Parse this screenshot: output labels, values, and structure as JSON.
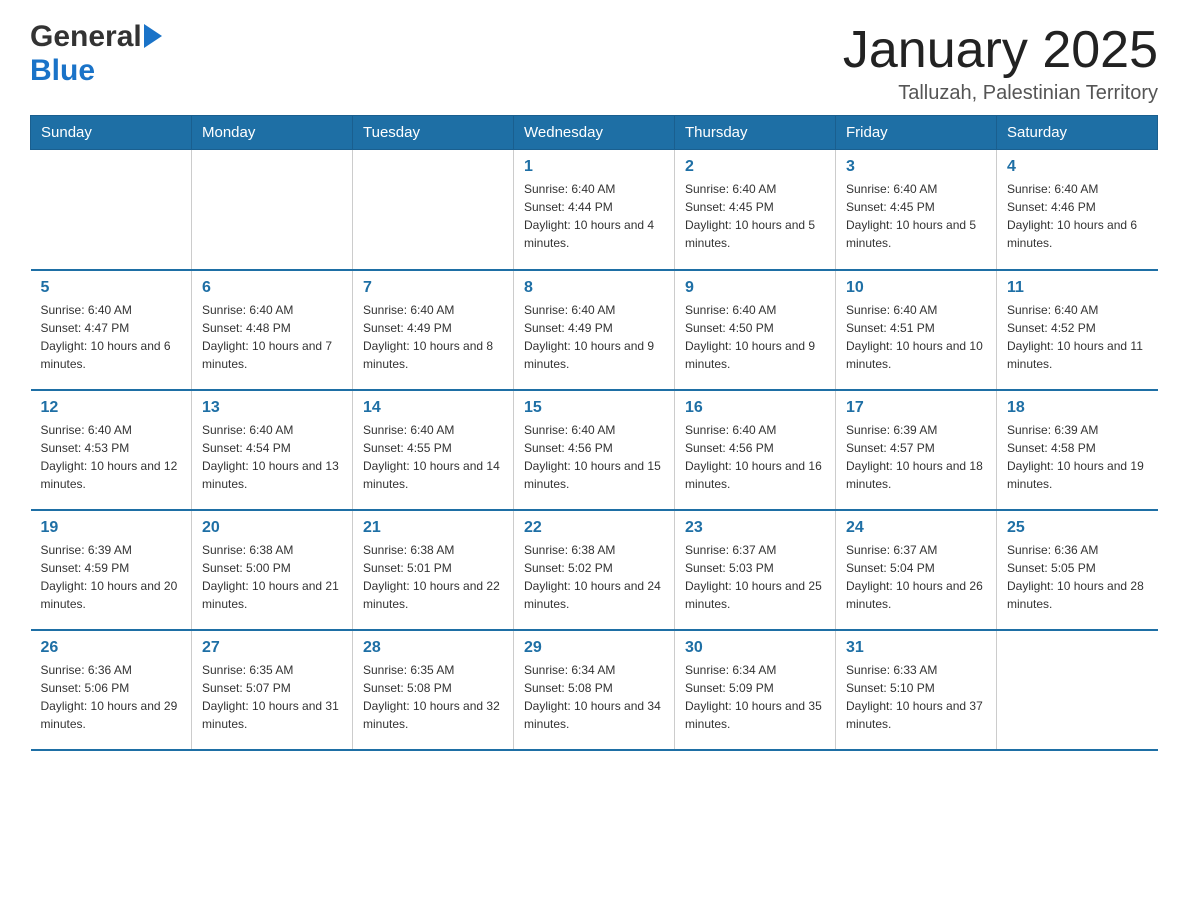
{
  "header": {
    "logo_general": "General",
    "logo_blue": "Blue",
    "month_title": "January 2025",
    "location": "Talluzah, Palestinian Territory"
  },
  "days_of_week": [
    "Sunday",
    "Monday",
    "Tuesday",
    "Wednesday",
    "Thursday",
    "Friday",
    "Saturday"
  ],
  "weeks": [
    [
      {
        "day": "",
        "info": ""
      },
      {
        "day": "",
        "info": ""
      },
      {
        "day": "",
        "info": ""
      },
      {
        "day": "1",
        "info": "Sunrise: 6:40 AM\nSunset: 4:44 PM\nDaylight: 10 hours and 4 minutes."
      },
      {
        "day": "2",
        "info": "Sunrise: 6:40 AM\nSunset: 4:45 PM\nDaylight: 10 hours and 5 minutes."
      },
      {
        "day": "3",
        "info": "Sunrise: 6:40 AM\nSunset: 4:45 PM\nDaylight: 10 hours and 5 minutes."
      },
      {
        "day": "4",
        "info": "Sunrise: 6:40 AM\nSunset: 4:46 PM\nDaylight: 10 hours and 6 minutes."
      }
    ],
    [
      {
        "day": "5",
        "info": "Sunrise: 6:40 AM\nSunset: 4:47 PM\nDaylight: 10 hours and 6 minutes."
      },
      {
        "day": "6",
        "info": "Sunrise: 6:40 AM\nSunset: 4:48 PM\nDaylight: 10 hours and 7 minutes."
      },
      {
        "day": "7",
        "info": "Sunrise: 6:40 AM\nSunset: 4:49 PM\nDaylight: 10 hours and 8 minutes."
      },
      {
        "day": "8",
        "info": "Sunrise: 6:40 AM\nSunset: 4:49 PM\nDaylight: 10 hours and 9 minutes."
      },
      {
        "day": "9",
        "info": "Sunrise: 6:40 AM\nSunset: 4:50 PM\nDaylight: 10 hours and 9 minutes."
      },
      {
        "day": "10",
        "info": "Sunrise: 6:40 AM\nSunset: 4:51 PM\nDaylight: 10 hours and 10 minutes."
      },
      {
        "day": "11",
        "info": "Sunrise: 6:40 AM\nSunset: 4:52 PM\nDaylight: 10 hours and 11 minutes."
      }
    ],
    [
      {
        "day": "12",
        "info": "Sunrise: 6:40 AM\nSunset: 4:53 PM\nDaylight: 10 hours and 12 minutes."
      },
      {
        "day": "13",
        "info": "Sunrise: 6:40 AM\nSunset: 4:54 PM\nDaylight: 10 hours and 13 minutes."
      },
      {
        "day": "14",
        "info": "Sunrise: 6:40 AM\nSunset: 4:55 PM\nDaylight: 10 hours and 14 minutes."
      },
      {
        "day": "15",
        "info": "Sunrise: 6:40 AM\nSunset: 4:56 PM\nDaylight: 10 hours and 15 minutes."
      },
      {
        "day": "16",
        "info": "Sunrise: 6:40 AM\nSunset: 4:56 PM\nDaylight: 10 hours and 16 minutes."
      },
      {
        "day": "17",
        "info": "Sunrise: 6:39 AM\nSunset: 4:57 PM\nDaylight: 10 hours and 18 minutes."
      },
      {
        "day": "18",
        "info": "Sunrise: 6:39 AM\nSunset: 4:58 PM\nDaylight: 10 hours and 19 minutes."
      }
    ],
    [
      {
        "day": "19",
        "info": "Sunrise: 6:39 AM\nSunset: 4:59 PM\nDaylight: 10 hours and 20 minutes."
      },
      {
        "day": "20",
        "info": "Sunrise: 6:38 AM\nSunset: 5:00 PM\nDaylight: 10 hours and 21 minutes."
      },
      {
        "day": "21",
        "info": "Sunrise: 6:38 AM\nSunset: 5:01 PM\nDaylight: 10 hours and 22 minutes."
      },
      {
        "day": "22",
        "info": "Sunrise: 6:38 AM\nSunset: 5:02 PM\nDaylight: 10 hours and 24 minutes."
      },
      {
        "day": "23",
        "info": "Sunrise: 6:37 AM\nSunset: 5:03 PM\nDaylight: 10 hours and 25 minutes."
      },
      {
        "day": "24",
        "info": "Sunrise: 6:37 AM\nSunset: 5:04 PM\nDaylight: 10 hours and 26 minutes."
      },
      {
        "day": "25",
        "info": "Sunrise: 6:36 AM\nSunset: 5:05 PM\nDaylight: 10 hours and 28 minutes."
      }
    ],
    [
      {
        "day": "26",
        "info": "Sunrise: 6:36 AM\nSunset: 5:06 PM\nDaylight: 10 hours and 29 minutes."
      },
      {
        "day": "27",
        "info": "Sunrise: 6:35 AM\nSunset: 5:07 PM\nDaylight: 10 hours and 31 minutes."
      },
      {
        "day": "28",
        "info": "Sunrise: 6:35 AM\nSunset: 5:08 PM\nDaylight: 10 hours and 32 minutes."
      },
      {
        "day": "29",
        "info": "Sunrise: 6:34 AM\nSunset: 5:08 PM\nDaylight: 10 hours and 34 minutes."
      },
      {
        "day": "30",
        "info": "Sunrise: 6:34 AM\nSunset: 5:09 PM\nDaylight: 10 hours and 35 minutes."
      },
      {
        "day": "31",
        "info": "Sunrise: 6:33 AM\nSunset: 5:10 PM\nDaylight: 10 hours and 37 minutes."
      },
      {
        "day": "",
        "info": ""
      }
    ]
  ]
}
